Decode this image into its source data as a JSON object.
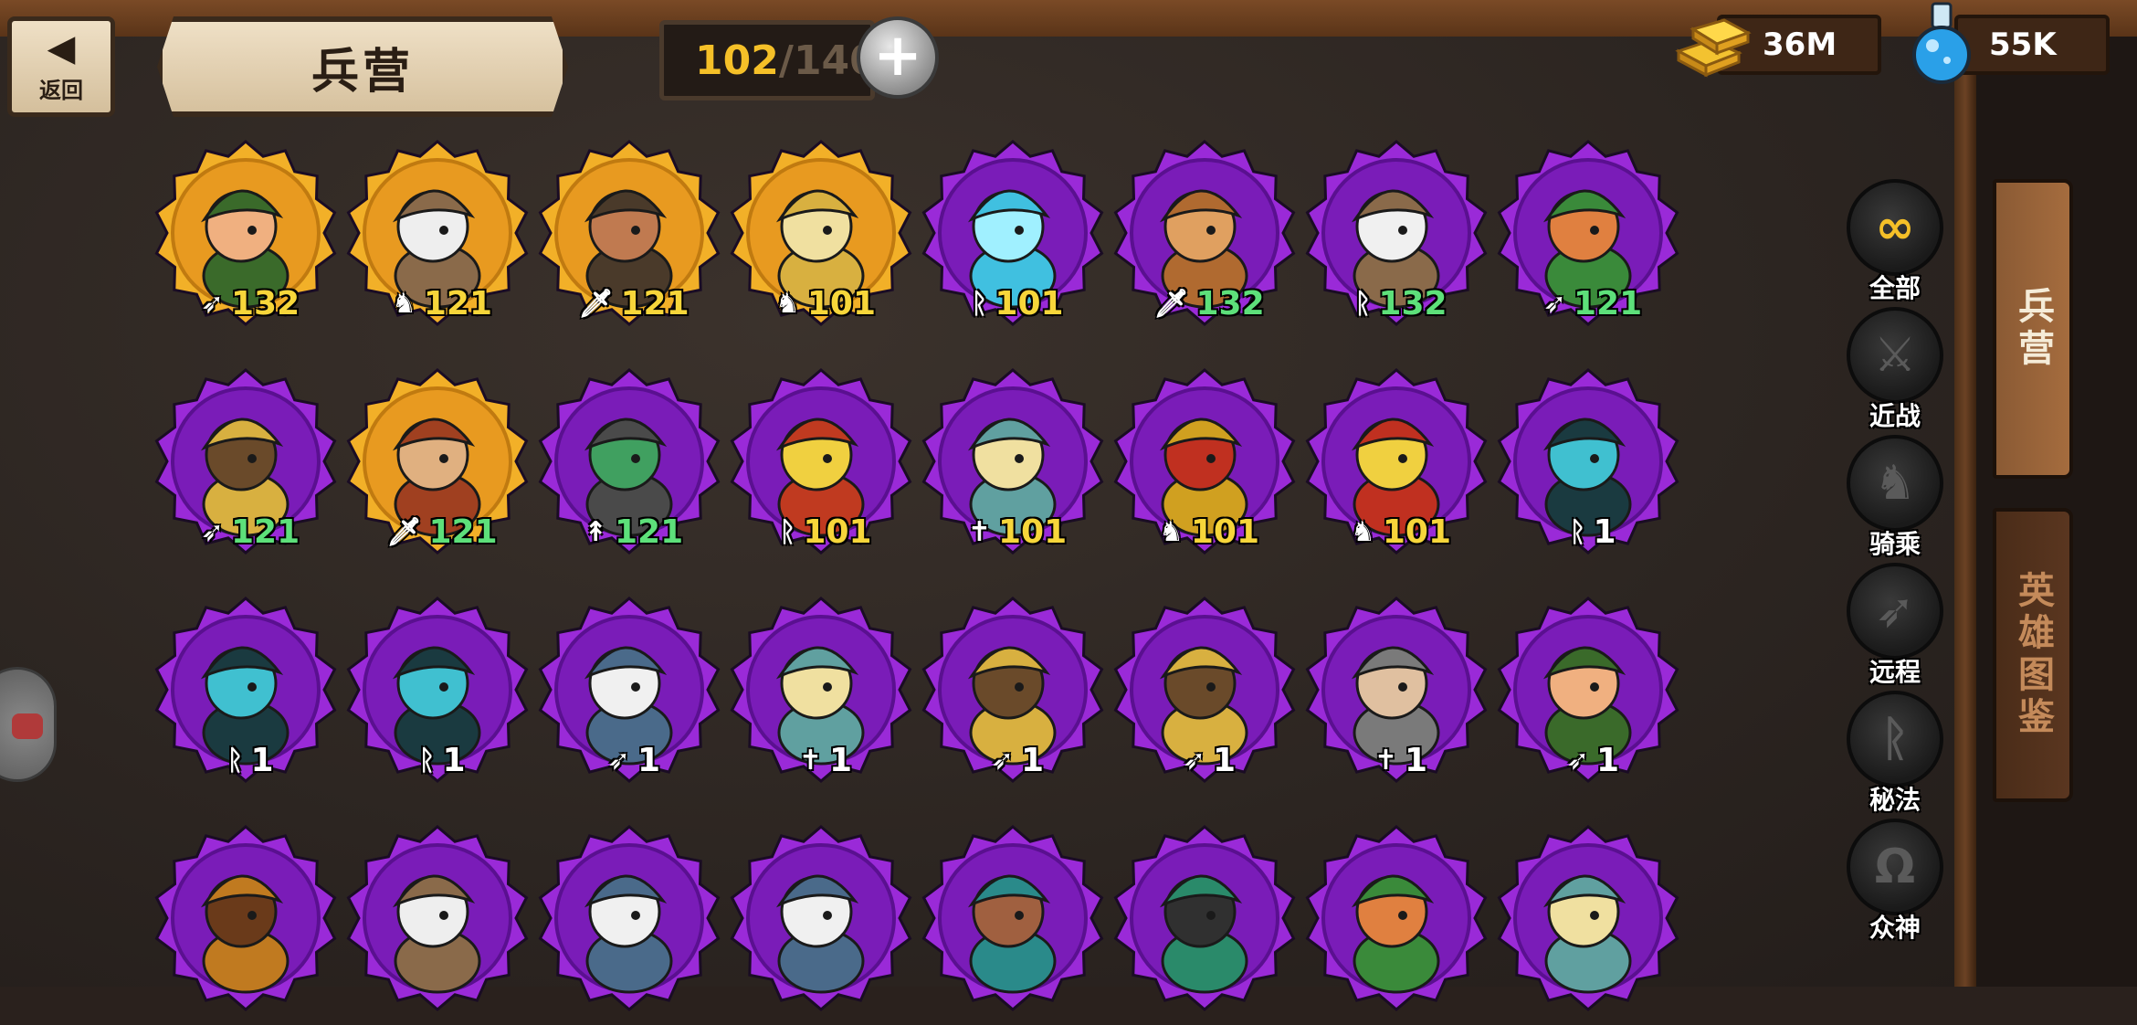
{
  "header": {
    "back_label": "返回",
    "title": "兵营",
    "troops": {
      "current": "102",
      "separator": "/",
      "max": "140"
    },
    "add_label": "+"
  },
  "currency": {
    "gold": "36M",
    "elixir": "55K"
  },
  "colors": {
    "orange_frame": "#e8a020",
    "purple_frame": "#8a22c8",
    "level_gold": "#f7d63a",
    "level_green": "#5de07a",
    "active_filter": "#f5c028"
  },
  "filters": [
    {
      "label": "全部",
      "icon": "infinity-icon",
      "glyph": "∞"
    },
    {
      "label": "近战",
      "icon": "sword-icon",
      "glyph": "⚔"
    },
    {
      "label": "骑乘",
      "icon": "horse-icon",
      "glyph": "♞"
    },
    {
      "label": "远程",
      "icon": "bow-icon",
      "glyph": "➶"
    },
    {
      "label": "秘法",
      "icon": "magic-rune-icon",
      "glyph": "ᚱ"
    },
    {
      "label": "众神",
      "icon": "omega-icon",
      "glyph": "Ω"
    }
  ],
  "side_tabs": [
    {
      "label": "兵营",
      "active": true
    },
    {
      "label": "英雄图鉴",
      "active": false
    }
  ],
  "units": [
    [
      {
        "name": "archer-ranger",
        "frame": "orange",
        "class": "bow-icon",
        "glyph": "➶",
        "level": "132",
        "level_color": "gold",
        "palette": [
          "#3a6a2a",
          "#f0b080"
        ]
      },
      {
        "name": "horned-rider",
        "frame": "orange",
        "class": "horse-icon",
        "glyph": "♞",
        "level": "121",
        "level_color": "gold",
        "palette": [
          "#8a6a4a",
          "#eeeeee"
        ]
      },
      {
        "name": "boar-warrior",
        "frame": "orange",
        "class": "sword-icon",
        "glyph": "🗡",
        "level": "121",
        "level_color": "gold",
        "palette": [
          "#4a3a2a",
          "#c07a50"
        ]
      },
      {
        "name": "golden-knight",
        "frame": "orange",
        "class": "horse-icon",
        "glyph": "♞",
        "level": "101",
        "level_color": "gold",
        "palette": [
          "#d8b040",
          "#f0e0a0"
        ]
      },
      {
        "name": "ghost-maiden",
        "frame": "purple",
        "class": "magic-rune-icon",
        "glyph": "ᚱ",
        "level": "101",
        "level_color": "gold",
        "palette": [
          "#40c0e0",
          "#a0f0ff"
        ]
      },
      {
        "name": "lion-warrior",
        "frame": "purple",
        "class": "sword-icon",
        "glyph": "🗡",
        "level": "132",
        "level_color": "green",
        "palette": [
          "#b06a30",
          "#e0a060"
        ]
      },
      {
        "name": "old-wizard",
        "frame": "purple",
        "class": "magic-rune-icon",
        "glyph": "ᚱ",
        "level": "132",
        "level_color": "green",
        "palette": [
          "#8a6a4a",
          "#f0f0f0"
        ]
      },
      {
        "name": "elf-archer",
        "frame": "purple",
        "class": "bow-icon",
        "glyph": "➶",
        "level": "121",
        "level_color": "green",
        "palette": [
          "#3a8a3a",
          "#e08040"
        ]
      }
    ],
    [
      {
        "name": "valkyrie-archer",
        "frame": "purple",
        "class": "bow-icon",
        "glyph": "➶",
        "level": "121",
        "level_color": "green",
        "palette": [
          "#d8b040",
          "#6a4a2a"
        ]
      },
      {
        "name": "swordsman",
        "frame": "orange",
        "class": "sword-icon",
        "glyph": "🗡",
        "level": "121",
        "level_color": "green",
        "palette": [
          "#a04020",
          "#e0b080"
        ]
      },
      {
        "name": "knight-spearman",
        "frame": "purple",
        "class": "spear-icon",
        "glyph": "↟",
        "level": "121",
        "level_color": "green",
        "palette": [
          "#4a4a4a",
          "#40a060"
        ]
      },
      {
        "name": "sun-priestess",
        "frame": "purple",
        "class": "magic-rune-icon",
        "glyph": "ᚱ",
        "level": "101",
        "level_color": "gold",
        "palette": [
          "#c03a20",
          "#f0d040"
        ]
      },
      {
        "name": "elf-cleric",
        "frame": "purple",
        "class": "cross-icon",
        "glyph": "✝",
        "level": "101",
        "level_color": "gold",
        "palette": [
          "#60a0a0",
          "#f0e0a0"
        ]
      },
      {
        "name": "spartan-rider",
        "frame": "purple",
        "class": "horse-icon",
        "glyph": "♞",
        "level": "101",
        "level_color": "gold",
        "palette": [
          "#d0a020",
          "#c03020"
        ]
      },
      {
        "name": "king-rider",
        "frame": "purple",
        "class": "horse-icon",
        "glyph": "♞",
        "level": "101",
        "level_color": "gold",
        "palette": [
          "#c03020",
          "#f0d040"
        ]
      },
      {
        "name": "hooded-mage",
        "frame": "purple",
        "class": "magic-rune-icon",
        "glyph": "ᚱ",
        "level": "1",
        "level_color": "white",
        "palette": [
          "#1a3a40",
          "#40c0d0"
        ]
      }
    ],
    [
      {
        "name": "hooded-mage",
        "frame": "purple",
        "class": "magic-rune-icon",
        "glyph": "ᚱ",
        "level": "1",
        "level_color": "white",
        "palette": [
          "#1a3a40",
          "#40c0d0"
        ]
      },
      {
        "name": "hooded-mage",
        "frame": "purple",
        "class": "magic-rune-icon",
        "glyph": "ᚱ",
        "level": "1",
        "level_color": "white",
        "palette": [
          "#1a3a40",
          "#40c0d0"
        ]
      },
      {
        "name": "cyclops-archer",
        "frame": "purple",
        "class": "bow-icon",
        "glyph": "➶",
        "level": "1",
        "level_color": "white",
        "palette": [
          "#4a6a8a",
          "#f0f0f0"
        ]
      },
      {
        "name": "elf-cleric",
        "frame": "purple",
        "class": "cross-icon",
        "glyph": "✝",
        "level": "1",
        "level_color": "white",
        "palette": [
          "#60a0a0",
          "#f0e0a0"
        ]
      },
      {
        "name": "valkyrie-archer",
        "frame": "purple",
        "class": "bow-icon",
        "glyph": "➶",
        "level": "1",
        "level_color": "white",
        "palette": [
          "#d8b040",
          "#6a4a2a"
        ]
      },
      {
        "name": "valkyrie-archer",
        "frame": "purple",
        "class": "bow-icon",
        "glyph": "➶",
        "level": "1",
        "level_color": "white",
        "palette": [
          "#d8b040",
          "#6a4a2a"
        ]
      },
      {
        "name": "owl-monk",
        "frame": "purple",
        "class": "cross-icon",
        "glyph": "✝",
        "level": "1",
        "level_color": "white",
        "palette": [
          "#7a7a7a",
          "#e0c0a0"
        ]
      },
      {
        "name": "archer-ranger",
        "frame": "purple",
        "class": "bow-icon",
        "glyph": "➶",
        "level": "1",
        "level_color": "white",
        "palette": [
          "#3a6a2a",
          "#f0b080"
        ]
      }
    ],
    [
      {
        "name": "spartan",
        "frame": "purple",
        "class": "",
        "glyph": "",
        "level": "",
        "level_color": "white",
        "palette": [
          "#c07a20",
          "#6a3a1a"
        ]
      },
      {
        "name": "horned-rider",
        "frame": "purple",
        "class": "",
        "glyph": "",
        "level": "",
        "level_color": "white",
        "palette": [
          "#8a6a4a",
          "#eeeeee"
        ]
      },
      {
        "name": "cyclops",
        "frame": "purple",
        "class": "",
        "glyph": "",
        "level": "",
        "level_color": "white",
        "palette": [
          "#4a6a8a",
          "#f0f0f0"
        ]
      },
      {
        "name": "cyclops",
        "frame": "purple",
        "class": "",
        "glyph": "",
        "level": "",
        "level_color": "white",
        "palette": [
          "#4a6a8a",
          "#f0f0f0"
        ]
      },
      {
        "name": "deer-rider",
        "frame": "purple",
        "class": "",
        "glyph": "",
        "level": "",
        "level_color": "white",
        "palette": [
          "#2a8a8a",
          "#a06040"
        ]
      },
      {
        "name": "deer-rider",
        "frame": "purple",
        "class": "",
        "glyph": "",
        "level": "",
        "level_color": "white",
        "palette": [
          "#2a8a6a",
          "#303030"
        ]
      },
      {
        "name": "elf-archer",
        "frame": "purple",
        "class": "",
        "glyph": "",
        "level": "",
        "level_color": "white",
        "palette": [
          "#3a8a3a",
          "#e08040"
        ]
      },
      {
        "name": "elf-cleric",
        "frame": "purple",
        "class": "",
        "glyph": "",
        "level": "",
        "level_color": "white",
        "palette": [
          "#60a0a0",
          "#f0e0a0"
        ]
      }
    ]
  ]
}
